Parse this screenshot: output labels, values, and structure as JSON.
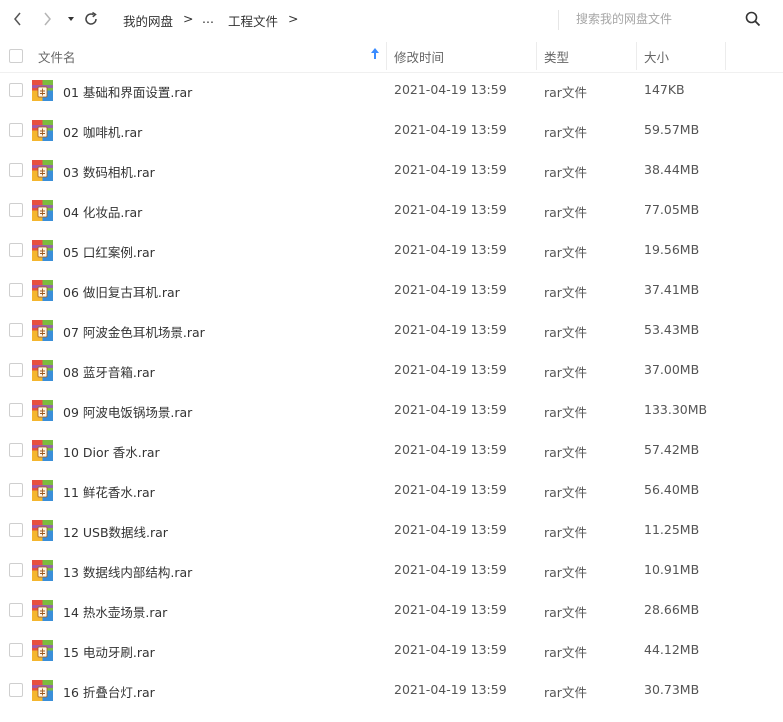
{
  "toolbar": {
    "breadcrumb": [
      "我的网盘",
      "...",
      "工程文件"
    ],
    "separator": ">",
    "search_placeholder": "搜索我的网盘文件"
  },
  "columns": {
    "name": "文件名",
    "modified": "修改时间",
    "type": "类型",
    "size": "大小"
  },
  "files": [
    {
      "name": "01 基础和界面设置.rar",
      "modified": "2021-04-19 13:59",
      "type": "rar文件",
      "size": "147KB"
    },
    {
      "name": "02 咖啡机.rar",
      "modified": "2021-04-19 13:59",
      "type": "rar文件",
      "size": "59.57MB"
    },
    {
      "name": "03 数码相机.rar",
      "modified": "2021-04-19 13:59",
      "type": "rar文件",
      "size": "38.44MB"
    },
    {
      "name": "04 化妆品.rar",
      "modified": "2021-04-19 13:59",
      "type": "rar文件",
      "size": "77.05MB"
    },
    {
      "name": "05 口红案例.rar",
      "modified": "2021-04-19 13:59",
      "type": "rar文件",
      "size": "19.56MB"
    },
    {
      "name": "06 做旧复古耳机.rar",
      "modified": "2021-04-19 13:59",
      "type": "rar文件",
      "size": "37.41MB"
    },
    {
      "name": "07 阿波金色耳机场景.rar",
      "modified": "2021-04-19 13:59",
      "type": "rar文件",
      "size": "53.43MB"
    },
    {
      "name": "08 蓝牙音箱.rar",
      "modified": "2021-04-19 13:59",
      "type": "rar文件",
      "size": "37.00MB"
    },
    {
      "name": "09 阿波电饭锅场景.rar",
      "modified": "2021-04-19 13:59",
      "type": "rar文件",
      "size": "133.30MB"
    },
    {
      "name": "10 Dior 香水.rar",
      "modified": "2021-04-19 13:59",
      "type": "rar文件",
      "size": "57.42MB"
    },
    {
      "name": "11 鲜花香水.rar",
      "modified": "2021-04-19 13:59",
      "type": "rar文件",
      "size": "56.40MB"
    },
    {
      "name": "12 USB数据线.rar",
      "modified": "2021-04-19 13:59",
      "type": "rar文件",
      "size": "11.25MB"
    },
    {
      "name": "13 数据线内部结构.rar",
      "modified": "2021-04-19 13:59",
      "type": "rar文件",
      "size": "10.91MB"
    },
    {
      "name": "14 热水壶场景.rar",
      "modified": "2021-04-19 13:59",
      "type": "rar文件",
      "size": "28.66MB"
    },
    {
      "name": "15 电动牙刷.rar",
      "modified": "2021-04-19 13:59",
      "type": "rar文件",
      "size": "44.12MB"
    },
    {
      "name": "16 折叠台灯.rar",
      "modified": "2021-04-19 13:59",
      "type": "rar文件",
      "size": "30.73MB"
    }
  ],
  "icons": {
    "back": "chevron-left-icon",
    "forward": "chevron-right-icon",
    "history": "caret-down-icon",
    "refresh": "refresh-icon",
    "search": "search-icon",
    "sort": "sort-ascending-icon",
    "file": "rar-archive-icon"
  },
  "colors": {
    "accent": "#3b8cff",
    "archive_icon": [
      "#e8423b",
      "#f7b32b",
      "#4caf50",
      "#2f8bd6",
      "#9b59b6"
    ]
  }
}
